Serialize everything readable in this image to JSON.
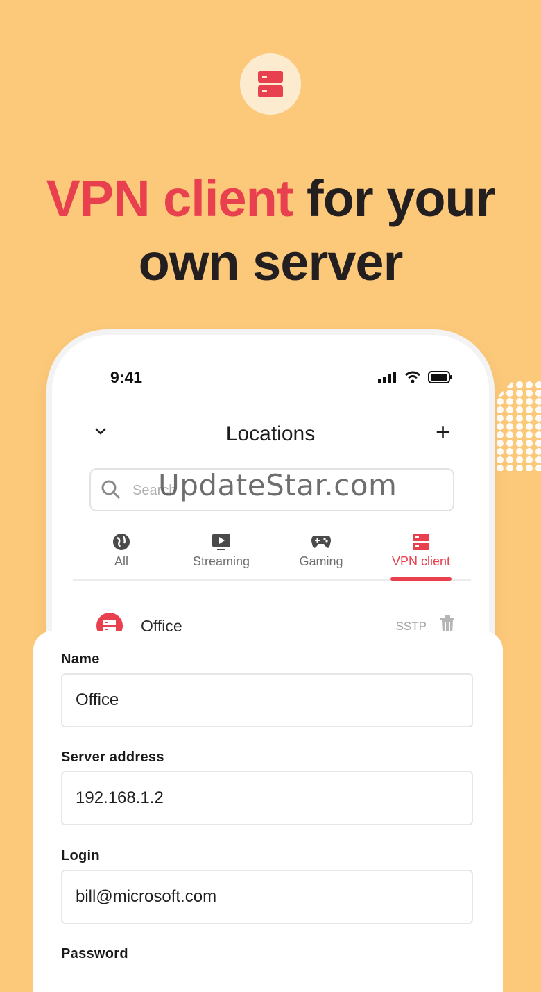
{
  "headline": {
    "accent": "VPN client",
    "rest_line1": "for your",
    "line2": "own server"
  },
  "status_bar": {
    "time": "9:41"
  },
  "nav": {
    "title": "Locations",
    "add_symbol": "+"
  },
  "search": {
    "placeholder": "Search"
  },
  "tabs": [
    {
      "label": "All",
      "icon": "globe-icon"
    },
    {
      "label": "Streaming",
      "icon": "play-icon"
    },
    {
      "label": "Gaming",
      "icon": "gamepad-icon"
    },
    {
      "label": "VPN client",
      "icon": "server-icon",
      "active": true
    }
  ],
  "location_row": {
    "name": "Office",
    "protocol": "SSTP"
  },
  "watermark": "UpdateStar.com",
  "form": {
    "name_label": "Name",
    "name_value": "Office",
    "server_label": "Server address",
    "server_value": "192.168.1.2",
    "login_label": "Login",
    "login_value": "bill@microsoft.com",
    "password_label": "Password"
  },
  "colors": {
    "background": "#fcc97a",
    "accent": "#e8404f",
    "text": "#231f20"
  }
}
